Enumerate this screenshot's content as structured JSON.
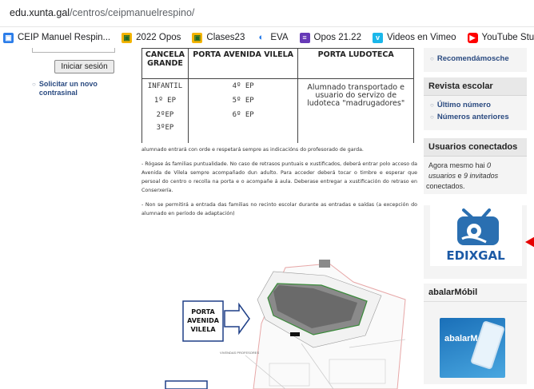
{
  "browser": {
    "url_host": "edu.xunta.gal",
    "url_path": "/centros/ceipmanuelrespino/"
  },
  "bookmarks": [
    {
      "label": "CEIP Manuel Respin...",
      "icon": "school-icon",
      "color": "#2b7de9"
    },
    {
      "label": "2022 Opos",
      "icon": "classroom-icon",
      "color": "#f4b400"
    },
    {
      "label": "Clases23",
      "icon": "classroom-icon",
      "color": "#f4b400"
    },
    {
      "label": "EVA",
      "icon": "eva-icon",
      "color": "#1a73e8"
    },
    {
      "label": "Opos 21.22",
      "icon": "forms-icon",
      "color": "#673ab7"
    },
    {
      "label": "Videos en Vimeo",
      "icon": "vimeo-icon",
      "color": "#1ab7ea"
    },
    {
      "label": "YouTube Studio",
      "icon": "youtube-icon",
      "color": "#ff0000"
    }
  ],
  "left": {
    "login_button": "Iniciar sesión",
    "register_link": "Solicitar un novo contrasinal"
  },
  "table": {
    "headers": [
      "CANCELA GRANDE",
      "PORTA AVENIDA VILELA",
      "PORTA LUDOTECA"
    ],
    "col1": [
      "INFANTIL",
      "1º EP",
      "2ºEP",
      "3ºEP"
    ],
    "col2": [
      "4º EP",
      "5º EP",
      "6º EP"
    ],
    "col3": "Alumnado transportado e usuario do servizo de ludoteca \"madrugadores\""
  },
  "paragraphs": [
    "alumnado entrará con orde e respetará sempre as indicacións do profesorado de garda.",
    "- Rógase ás familias puntualidade. No caso de retrasos puntuais e xustificados, deberá entrar polo acceso da Avenida de Vilela sempre acompañado dun adulto. Para acceder deberá tocar o timbre e esperar que persoal do centro o recolla na porta e o acompañe á aula. Deberase entregar a xustificación do retraso en Conserxería.",
    "- Non se permitirá a entrada das familias no recinto escolar durante as entradas e saídas (a excepción do alumnado en período de adaptación)"
  ],
  "map": {
    "gate_label": "PORTA AVENIDA VILELA",
    "small_label": "VIVENDAS PROFESORES"
  },
  "right": {
    "top_link": "Recomendámosche",
    "revista_title": "Revista escolar",
    "revista_links": [
      "Último número",
      "Números anteriores"
    ],
    "users_title": "Usuarios conectados",
    "users_text_a": "Agora mesmo hai ",
    "users_count": "0",
    "users_text_b": "usuarios",
    "users_text_c": " e ",
    "users_guests": "9 invitados",
    "users_text_d": " conectados.",
    "edixgal_label": "EDIXGAL",
    "abalar_title": "abalarMóbil",
    "abalar_logo": "abalarMóbil"
  }
}
